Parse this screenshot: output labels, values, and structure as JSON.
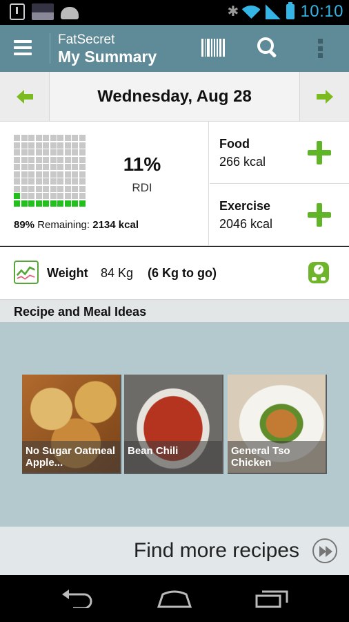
{
  "status_bar": {
    "time": "10:10",
    "icons": [
      "download-icon",
      "panasonic-icon",
      "android-robot-icon",
      "bluetooth-icon",
      "wifi-icon",
      "signal-icon",
      "battery-icon"
    ]
  },
  "action_bar": {
    "app_name": "FatSecret",
    "title": "My Summary",
    "icons": [
      "menu-icon",
      "barcode-icon",
      "search-icon",
      "overflow-icon"
    ]
  },
  "date_bar": {
    "date": "Wednesday, Aug 28",
    "prev_icon": "arrow-left-icon",
    "next_icon": "arrow-right-icon"
  },
  "summary": {
    "rdi_percent": "11%",
    "rdi_label": "RDI",
    "rdi_fraction": 0.11,
    "remaining_percent": "89%",
    "remaining_label": " Remaining: ",
    "remaining_kcal": "2134 kcal",
    "food_label": "Food",
    "food_value": "266 kcal",
    "exercise_label": "Exercise",
    "exercise_value": "2046 kcal"
  },
  "weight": {
    "label": "Weight",
    "value": "84 Kg",
    "goal": "(6 Kg to go)"
  },
  "recipes": {
    "header": "Recipe and Meal Ideas",
    "items": [
      {
        "name": "No Sugar Oatmeal Apple..."
      },
      {
        "name": "Bean Chili"
      },
      {
        "name": "General Tso Chicken"
      }
    ],
    "find_more": "Find more recipes"
  },
  "colors": {
    "action_bar": "#5f8a97",
    "accent_green": "#5fb427",
    "status_blue": "#35b5e5"
  }
}
